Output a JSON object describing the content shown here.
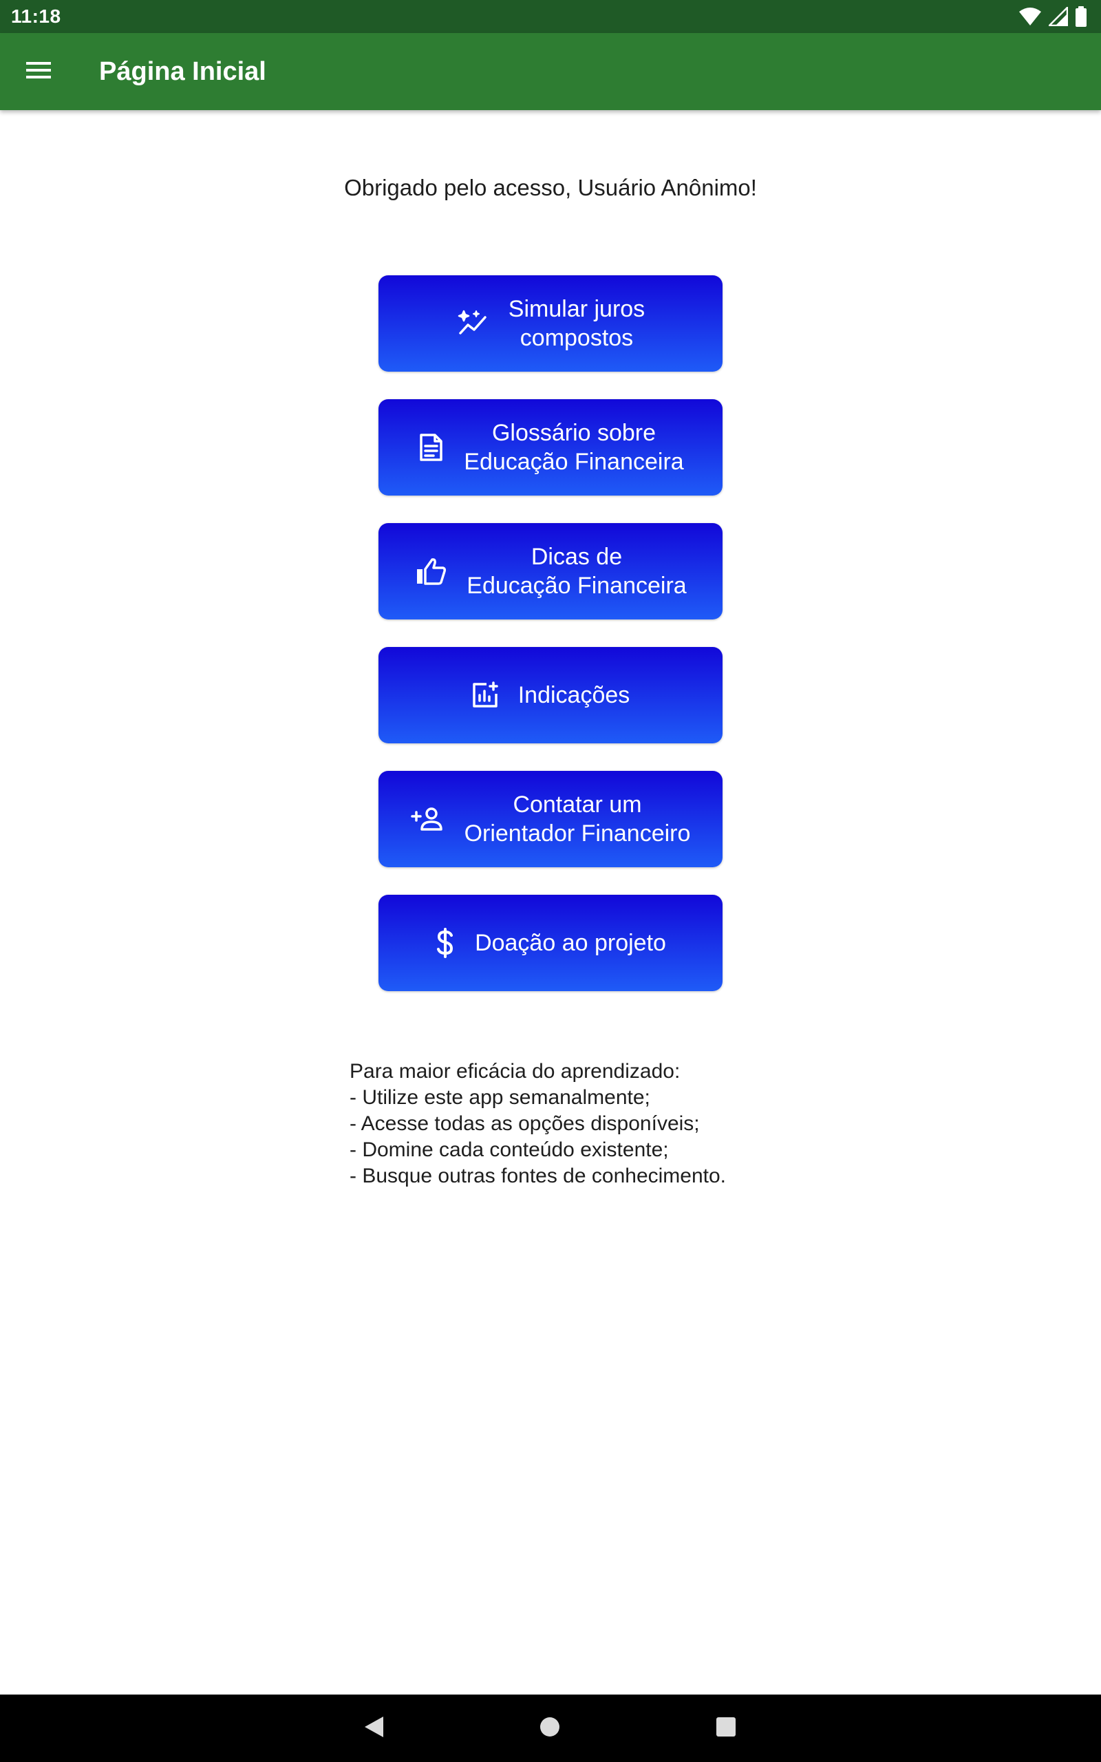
{
  "status_bar": {
    "time": "11:18",
    "icons": [
      "wifi-icon",
      "signal-icon",
      "battery-icon"
    ]
  },
  "app_bar": {
    "menu_icon": "menu-icon",
    "title": "Página Inicial",
    "color": "#2e7d32"
  },
  "greeting": "Obrigado pelo acesso, Usuário Anônimo!",
  "buttons": [
    {
      "icon": "auto-graph-icon",
      "lines": [
        "Simular juros",
        "compostos"
      ]
    },
    {
      "icon": "article-icon",
      "lines": [
        "Glossário sobre",
        "Educação Financeira"
      ]
    },
    {
      "icon": "thumb-up-icon",
      "lines": [
        "Dicas de",
        "Educação Financeira"
      ]
    },
    {
      "icon": "insights-icon",
      "lines": [
        "Indicações"
      ]
    },
    {
      "icon": "person-add-icon",
      "lines": [
        "Contatar um",
        "Orientador Financeiro"
      ]
    },
    {
      "icon": "dollar-icon",
      "lines": [
        "Doação ao projeto"
      ]
    }
  ],
  "tips": [
    "Para maior eficácia do aprendizado:",
    "- Utilize este app semanalmente;",
    "- Acesse todas as opções disponíveis;",
    "- Domine cada conteúdo existente;",
    "- Busque outras fontes de conhecimento."
  ],
  "nav_bar": {
    "icons": [
      "back-icon",
      "home-icon",
      "recents-icon"
    ]
  },
  "colors": {
    "button_gradient_top": "#1208d9",
    "button_gradient_bottom": "#1f5bf7",
    "status_bar": "#1f5a26"
  }
}
